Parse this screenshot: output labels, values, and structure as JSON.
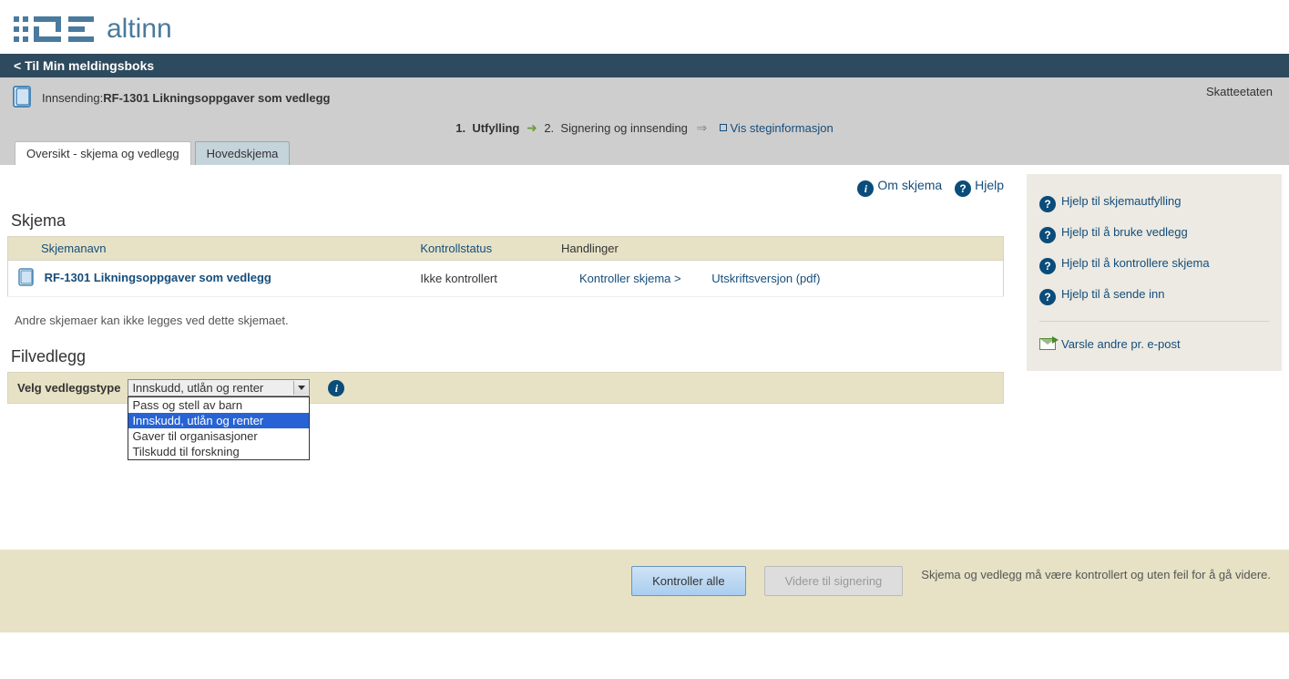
{
  "logo_text": "altinn",
  "navbar": {
    "back_label": "Til Min meldingsboks"
  },
  "title": {
    "prefix": "Innsending:",
    "name": "RF-1301 Likningsoppgaver som vedlegg",
    "agency": "Skatteetaten"
  },
  "steps": {
    "step1_num": "1.",
    "step1_label": "Utfylling",
    "step2_num": "2.",
    "step2_label": "Signering og innsending",
    "info_link": "Vis steginformasjon"
  },
  "tabs": {
    "overview": "Oversikt - skjema og vedlegg",
    "main_schema": "Hovedskjema"
  },
  "top_links": {
    "about": "Om skjema",
    "help": "Hjelp"
  },
  "schema_section": {
    "title": "Skjema",
    "headers": {
      "name": "Skjemanavn",
      "status": "Kontrollstatus",
      "actions": "Handlinger"
    },
    "row": {
      "name": "RF-1301 Likningsoppgaver som vedlegg",
      "status": "Ikke kontrollert",
      "action_check": "Kontroller skjema >",
      "action_print": "Utskriftsversjon (pdf)"
    },
    "note": "Andre skjemaer kan ikke legges ved dette skjemaet."
  },
  "attachments": {
    "title": "Filvedlegg",
    "label": "Velg vedleggstype",
    "selected": "Innskudd, utlån og renter",
    "options": [
      "Pass og stell av barn",
      "Innskudd, utlån og renter",
      "Gaver til organisasjoner",
      "Tilskudd til forskning"
    ]
  },
  "sidebar": {
    "help_fill": "Hjelp til skjemautfylling",
    "help_attach": "Hjelp til å bruke vedlegg",
    "help_check": "Hjelp til å kontrollere skjema",
    "help_send": "Hjelp til å sende inn",
    "notify": "Varsle andre pr. e-post"
  },
  "footer": {
    "check_all": "Kontroller alle",
    "proceed": "Videre til signering",
    "note": "Skjema og vedlegg må være kontrollert og uten feil for å gå videre."
  }
}
